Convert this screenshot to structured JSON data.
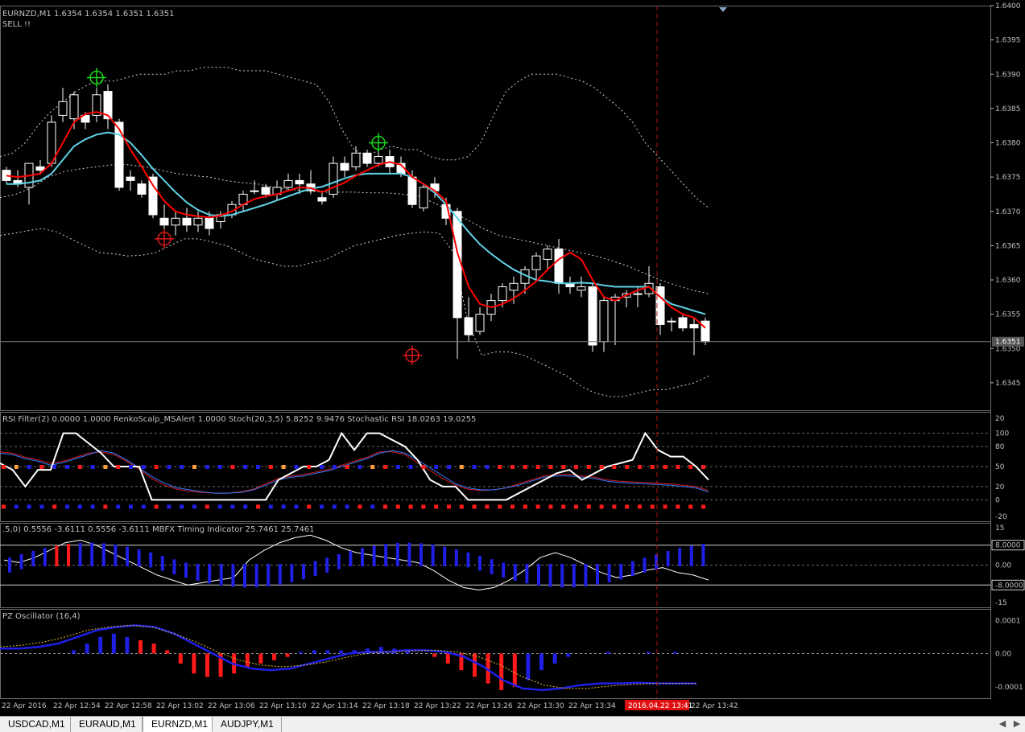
{
  "colors": {
    "bull": "#ffffff",
    "bear": "#ffffff",
    "ema_red": "#ff0000",
    "ema_cyan": "#5fd3e6",
    "band": "#cfcfcf",
    "grid": "#8a8a8a",
    "text": "#c0c0c0",
    "vline": "#b01818",
    "blue": "#1f1fe6",
    "red": "#ff1a1a",
    "orange": "#ff9f40"
  },
  "chart_data": [
    {
      "type": "candlestick",
      "title": "EURNZD,M1  1.6354 1.6354 1.6351 1.6351",
      "annotation": "SELL !!",
      "ylim": [
        1.6341,
        1.64
      ],
      "y_ticks": [
        "1.6400",
        "1.6395",
        "1.6390",
        "1.6385",
        "1.6380",
        "1.6375",
        "1.6370",
        "1.6365",
        "1.6360",
        "1.6355",
        "1.6350",
        "1.6345"
      ],
      "current_price": "1.6351",
      "x_labels": [
        "22 Apr 2016",
        "22 Apr 12:54",
        "22 Apr 12:58",
        "22 Apr 13:02",
        "22 Apr 13:06",
        "22 Apr 13:10",
        "22 Apr 13:14",
        "22 Apr 13:18",
        "22 Apr 13:22",
        "22 Apr 13:26",
        "22 Apr 13:30",
        "22 Apr 13:34",
        "2016.04.22 13:41",
        "22 Apr 13:42"
      ],
      "cursor_time": "2016.04.22 13:41",
      "candles": [
        [
          1.6376,
          1.63765,
          1.6374,
          1.63745
        ],
        [
          1.63745,
          1.6376,
          1.63735,
          1.6374
        ],
        [
          1.63735,
          1.6377,
          1.6371,
          1.6377
        ],
        [
          1.63765,
          1.63775,
          1.63755,
          1.6376
        ],
        [
          1.6377,
          1.6384,
          1.63765,
          1.6383
        ],
        [
          1.6384,
          1.6388,
          1.6383,
          1.6386
        ],
        [
          1.63835,
          1.63875,
          1.6382,
          1.6387
        ],
        [
          1.6384,
          1.63845,
          1.6382,
          1.6383
        ],
        [
          1.6384,
          1.6388,
          1.6383,
          1.6387
        ],
        [
          1.63875,
          1.63885,
          1.6382,
          1.63835
        ],
        [
          1.6383,
          1.63835,
          1.6373,
          1.63735
        ],
        [
          1.6375,
          1.6376,
          1.6373,
          1.63745
        ],
        [
          1.6374,
          1.63745,
          1.6372,
          1.63725
        ],
        [
          1.6375,
          1.63755,
          1.6369,
          1.63695
        ],
        [
          1.6369,
          1.6371,
          1.6367,
          1.6368
        ],
        [
          1.6368,
          1.637,
          1.63665,
          1.6369
        ],
        [
          1.6369,
          1.63705,
          1.6367,
          1.6368
        ],
        [
          1.6368,
          1.637,
          1.6367,
          1.6369
        ],
        [
          1.6369,
          1.637,
          1.63665,
          1.63675
        ],
        [
          1.63685,
          1.637,
          1.63675,
          1.63695
        ],
        [
          1.63695,
          1.63715,
          1.6369,
          1.6371
        ],
        [
          1.6371,
          1.6373,
          1.637,
          1.63725
        ],
        [
          1.6373,
          1.63745,
          1.63725,
          1.6373
        ],
        [
          1.63735,
          1.6374,
          1.6372,
          1.63725
        ],
        [
          1.63725,
          1.63745,
          1.63715,
          1.63735
        ],
        [
          1.63735,
          1.63755,
          1.6373,
          1.63745
        ],
        [
          1.63745,
          1.63755,
          1.63725,
          1.6374
        ],
        [
          1.6374,
          1.6376,
          1.63725,
          1.6373
        ],
        [
          1.6372,
          1.6373,
          1.6371,
          1.63715
        ],
        [
          1.63725,
          1.6378,
          1.6372,
          1.6377
        ],
        [
          1.6377,
          1.6378,
          1.6375,
          1.6376
        ],
        [
          1.63765,
          1.63795,
          1.6376,
          1.63785
        ],
        [
          1.63785,
          1.6379,
          1.63765,
          1.6377
        ],
        [
          1.6377,
          1.6379,
          1.63765,
          1.6378
        ],
        [
          1.6378,
          1.6379,
          1.63755,
          1.63765
        ],
        [
          1.6377,
          1.6378,
          1.6375,
          1.63755
        ],
        [
          1.6375,
          1.6376,
          1.63705,
          1.6371
        ],
        [
          1.63705,
          1.6374,
          1.637,
          1.63735
        ],
        [
          1.6374,
          1.6375,
          1.6372,
          1.6373
        ],
        [
          1.6371,
          1.6372,
          1.6368,
          1.6369
        ],
        [
          1.637,
          1.63705,
          1.63485,
          1.63545
        ],
        [
          1.63545,
          1.63575,
          1.6351,
          1.6352
        ],
        [
          1.63525,
          1.6356,
          1.6352,
          1.6355
        ],
        [
          1.6355,
          1.6358,
          1.6354,
          1.6357
        ],
        [
          1.6357,
          1.63595,
          1.6356,
          1.6359
        ],
        [
          1.63585,
          1.63605,
          1.63565,
          1.63595
        ],
        [
          1.63595,
          1.6362,
          1.6358,
          1.63615
        ],
        [
          1.63615,
          1.6364,
          1.636,
          1.63635
        ],
        [
          1.6363,
          1.6365,
          1.63615,
          1.63645
        ],
        [
          1.63645,
          1.6366,
          1.6358,
          1.63595
        ],
        [
          1.63595,
          1.63605,
          1.6358,
          1.6359
        ],
        [
          1.63585,
          1.63605,
          1.63575,
          1.6359
        ],
        [
          1.6359,
          1.63595,
          1.63495,
          1.63505
        ],
        [
          1.6351,
          1.63575,
          1.63495,
          1.6357
        ],
        [
          1.6357,
          1.6358,
          1.63505,
          1.63575
        ],
        [
          1.63575,
          1.63585,
          1.6356,
          1.6358
        ],
        [
          1.6358,
          1.6359,
          1.6356,
          1.6358
        ],
        [
          1.6358,
          1.6362,
          1.63575,
          1.63595
        ],
        [
          1.6359,
          1.63595,
          1.6352,
          1.63535
        ],
        [
          1.6354,
          1.63545,
          1.63525,
          1.6354
        ],
        [
          1.63545,
          1.6355,
          1.63525,
          1.6353
        ],
        [
          1.63535,
          1.63545,
          1.6349,
          1.6353
        ],
        [
          1.6354,
          1.63545,
          1.63505,
          1.6351
        ]
      ],
      "ema_red": [
        1.63752,
        1.6375,
        1.63752,
        1.63755,
        1.6377,
        1.638,
        1.6383,
        1.63842,
        1.63845,
        1.6384,
        1.6382,
        1.6379,
        1.63765,
        1.63738,
        1.63715,
        1.637,
        1.63695,
        1.63693,
        1.63691,
        1.63694,
        1.637,
        1.6371,
        1.63718,
        1.63722,
        1.63725,
        1.6373,
        1.63735,
        1.63734,
        1.63728,
        1.63735,
        1.63742,
        1.63752,
        1.6376,
        1.63768,
        1.63772,
        1.63768,
        1.6375,
        1.6374,
        1.6373,
        1.63715,
        1.6364,
        1.6359,
        1.63565,
        1.6356,
        1.63565,
        1.63573,
        1.63585,
        1.63598,
        1.63615,
        1.6363,
        1.6364,
        1.6363,
        1.636,
        1.63575,
        1.6357,
        1.63578,
        1.63585,
        1.6359,
        1.63575,
        1.6356,
        1.6355,
        1.63545,
        1.6353
      ],
      "ema_cyan": [
        1.6374,
        1.6374,
        1.63742,
        1.63745,
        1.63755,
        1.63775,
        1.63795,
        1.63805,
        1.63812,
        1.63815,
        1.63812,
        1.638,
        1.63782,
        1.63762,
        1.63745,
        1.63728,
        1.63713,
        1.63702,
        1.63695,
        1.63693,
        1.63695,
        1.637,
        1.63705,
        1.6371,
        1.63716,
        1.63722,
        1.63728,
        1.63733,
        1.63736,
        1.63742,
        1.63748,
        1.63753,
        1.63755,
        1.63755,
        1.63755,
        1.63755,
        1.6375,
        1.6374,
        1.63727,
        1.6371,
        1.6369,
        1.6367,
        1.63652,
        1.63638,
        1.63626,
        1.63615,
        1.63607,
        1.636,
        1.63598,
        1.63595,
        1.63595,
        1.63596,
        1.63595,
        1.63592,
        1.6359,
        1.6359,
        1.6359,
        1.6359,
        1.63575,
        1.63565,
        1.6356,
        1.63555,
        1.6355
      ],
      "band_upper": [
        1.6378,
        1.63785,
        1.638,
        1.63825,
        1.63845,
        1.6386,
        1.63875,
        1.63885,
        1.6389,
        1.6389,
        1.63895,
        1.639,
        1.639,
        1.639,
        1.63905,
        1.63905,
        1.6391,
        1.6391,
        1.6391,
        1.63905,
        1.63905,
        1.63905,
        1.639,
        1.63895,
        1.6389,
        1.63885,
        1.6386,
        1.6382,
        1.6379,
        1.6378,
        1.6379,
        1.63795,
        1.6379,
        1.6379,
        1.6378,
        1.63775,
        1.63775,
        1.6378,
        1.638,
        1.6384,
        1.63875,
        1.6389,
        1.639,
        1.639,
        1.639,
        1.63895,
        1.6389,
        1.6388,
        1.63865,
        1.6385,
        1.6383,
        1.638,
        1.6378,
        1.6376,
        1.6374,
        1.6372,
        1.63705
      ],
      "band_mid": [
        1.6372,
        1.63725,
        1.63735,
        1.6375,
        1.63758,
        1.63762,
        1.63765,
        1.63768,
        1.63768,
        1.63765,
        1.6376,
        1.63755,
        1.63752,
        1.6375,
        1.63745,
        1.63742,
        1.6374,
        1.63735,
        1.63732,
        1.6373,
        1.63728,
        1.63728,
        1.63728,
        1.63727,
        1.63727,
        1.63725,
        1.63722,
        1.63712,
        1.637,
        1.63688,
        1.63675,
        1.63665,
        1.6366,
        1.63655,
        1.6365,
        1.63645,
        1.6364,
        1.63635,
        1.63628,
        1.6362,
        1.6361,
        1.636,
        1.63592,
        1.63585,
        1.6358
      ],
      "band_lower": [
        1.63665,
        1.63668,
        1.63672,
        1.63675,
        1.6367,
        1.6366,
        1.6365,
        1.6364,
        1.63638,
        1.63635,
        1.63636,
        1.6364,
        1.6365,
        1.6366,
        1.6366,
        1.63655,
        1.6365,
        1.6364,
        1.6363,
        1.63625,
        1.6362,
        1.6362,
        1.63625,
        1.6363,
        1.6364,
        1.6365,
        1.63655,
        1.6366,
        1.63665,
        1.63668,
        1.6367,
        1.63668,
        1.6364,
        1.6354,
        1.6349,
        1.63495,
        1.63495,
        1.6349,
        1.6348,
        1.6347,
        1.6346,
        1.63445,
        1.63435,
        1.6343,
        1.6343,
        1.63435,
        1.6344,
        1.6344,
        1.63445,
        1.6345,
        1.6346
      ],
      "markers": [
        {
          "type": "buy",
          "idx": 8,
          "price": 1.63895
        },
        {
          "type": "buy",
          "idx": 33,
          "price": 1.638
        },
        {
          "type": "sell",
          "idx": 14,
          "price": 1.6366
        },
        {
          "type": "sell",
          "idx": 36,
          "price": 1.6349
        }
      ]
    },
    {
      "type": "line",
      "title": "RSI Filter(2) 0.0000 1.0000  RenkoScalp_MSAlert 1.0000  Stoch(20,3,5) 5.8252 9.9476  Stochastic RSI 18.0263 19.0255",
      "y_ticks": [
        "20",
        "100",
        "80",
        "50",
        "20",
        "0",
        "-20"
      ],
      "series": [
        {
          "values": [
            55,
            45,
            20,
            45,
            45,
            100,
            100,
            85,
            70,
            50,
            50,
            50,
            0,
            0,
            0,
            0,
            0,
            0,
            0,
            0,
            0,
            0,
            30,
            40,
            50,
            50,
            60,
            100,
            75,
            100,
            100,
            90,
            80,
            60,
            30,
            20,
            20,
            0,
            0,
            0,
            0,
            10,
            20,
            30,
            40,
            45,
            30,
            40,
            50,
            55,
            60,
            100,
            75,
            65,
            65,
            50,
            30
          ]
        },
        {
          "values": [
            70,
            68,
            62,
            58,
            52,
            56,
            62,
            68,
            74,
            70,
            60,
            48,
            35,
            25,
            18,
            15,
            12,
            10,
            10,
            11,
            15,
            22,
            30,
            34,
            36,
            40,
            44,
            50,
            56,
            62,
            70,
            74,
            70,
            60,
            48,
            36,
            24,
            18,
            15,
            15,
            18,
            22,
            28,
            34,
            36,
            36,
            34,
            32,
            28,
            26,
            25,
            24,
            23,
            22,
            20,
            18,
            12
          ]
        },
        {
          "values": [
            72,
            70,
            64,
            60,
            55,
            58,
            64,
            70,
            72,
            68,
            58,
            46,
            32,
            22,
            16,
            13,
            11,
            10,
            10,
            12,
            16,
            24,
            32,
            36,
            38,
            42,
            46,
            52,
            58,
            64,
            72,
            72,
            68,
            56,
            44,
            32,
            22,
            16,
            14,
            15,
            18,
            24,
            30,
            36,
            38,
            38,
            36,
            34,
            30,
            28,
            27,
            26,
            25,
            24,
            22,
            20,
            14
          ]
        }
      ],
      "dots": {
        "upper": 50,
        "lower": 0
      }
    },
    {
      "type": "bar",
      "title": ".5,0) 0.5556 -3.6111 0.5556 -3.6111  MBFX Timing Indicator 25.7461 25.7461",
      "y_ticks": [
        "15",
        "8.0000",
        "0.00",
        "-8.0000",
        "-15"
      ],
      "levels": [
        8,
        -8
      ]
    },
    {
      "type": "bar",
      "title": "PZ Oscillator (16,4)",
      "y_ticks": [
        "0.0001",
        "0.00",
        "-0.0001"
      ]
    }
  ],
  "tabs": [
    {
      "label": "USDCAD,M1",
      "active": false
    },
    {
      "label": "EURAUD,M1",
      "active": false
    },
    {
      "label": "EURNZD,M1",
      "active": true
    },
    {
      "label": "AUDJPY,M1",
      "active": false
    }
  ],
  "scroll": {
    "left": "◀",
    "right": "▶"
  }
}
